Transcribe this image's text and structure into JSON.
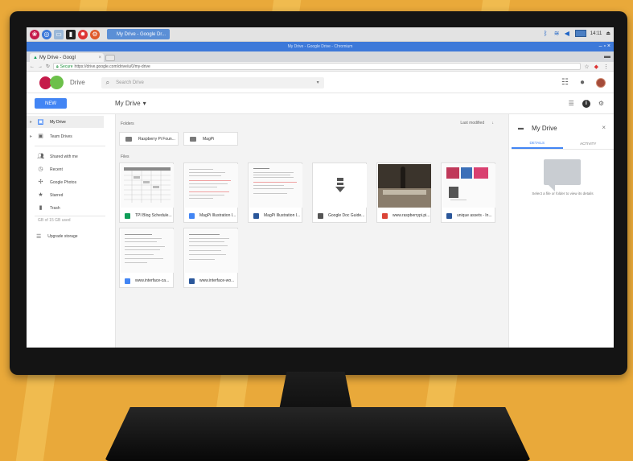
{
  "os_panel": {
    "taskbar_window": "My Drive - Google Dr...",
    "clock": "14:11"
  },
  "window": {
    "title": "My Drive - Google Drive - Chromium",
    "controls": "– ▫ ×"
  },
  "browser": {
    "tab_title": "My Drive - Googl",
    "secure_label": "Secure",
    "url": "https://drive.google.com/drive/u/0/my-drive"
  },
  "drive": {
    "app_name": "Drive",
    "search_placeholder": "Search Drive",
    "new_button": "NEW",
    "location": "My Drive",
    "sidebar": {
      "items": [
        {
          "label": "My Drive",
          "icon": "my-drive-icon"
        },
        {
          "label": "Team Drives",
          "icon": "team-drives-icon"
        },
        {
          "label": "Shared with me",
          "icon": "people-icon"
        },
        {
          "label": "Recent",
          "icon": "clock-icon"
        },
        {
          "label": "Google Photos",
          "icon": "photos-icon"
        },
        {
          "label": "Starred",
          "icon": "star-icon"
        },
        {
          "label": "Trash",
          "icon": "trash-icon"
        }
      ],
      "storage_label": "GB of 15 GB used",
      "upgrade_label": "Upgrade storage"
    },
    "content": {
      "folders_label": "Folders",
      "files_label": "Files",
      "sort_label": "Last modified",
      "folders": [
        {
          "name": "Raspberry Pi Foun..."
        },
        {
          "name": "MagPi"
        }
      ],
      "files": [
        {
          "name": "TPI Blog Schedule...",
          "type": "sheet",
          "color": "#0f9d58"
        },
        {
          "name": "MagPi Illustration I...",
          "type": "doc",
          "color": "#4285f4"
        },
        {
          "name": "MagPi Illustration I...",
          "type": "word",
          "color": "#2b579a"
        },
        {
          "name": "Google Doc Guide...",
          "type": "download",
          "color": "#555555"
        },
        {
          "name": "www.raspberrypi.pi...",
          "type": "pdf",
          "color": "#db4437"
        },
        {
          "name": "unique assets - In...",
          "type": "word",
          "color": "#2b579a"
        },
        {
          "name": "www.interface-ca...",
          "type": "doc",
          "color": "#4285f4"
        },
        {
          "name": "www.interface-wo...",
          "type": "word",
          "color": "#2b579a"
        }
      ]
    },
    "details": {
      "title": "My Drive",
      "tabs": [
        "DETAILS",
        "ACTIVITY"
      ],
      "empty_message": "Select a file or folder to view its details"
    }
  },
  "colors": {
    "accent": "#4285f4",
    "background": "#e9a93a",
    "bezel": "#141414"
  }
}
